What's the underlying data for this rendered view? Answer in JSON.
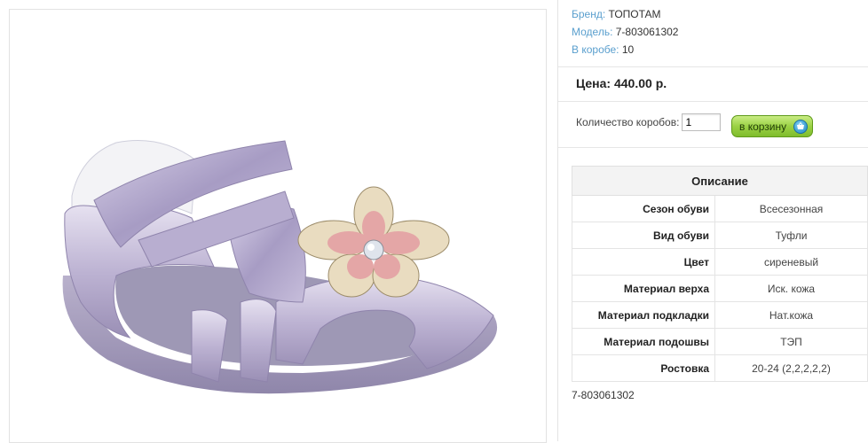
{
  "product": {
    "brand_label": "Бренд:",
    "brand": "ТОПОТАМ",
    "model_label": "Модель:",
    "model": "7-803061302",
    "box_label": "В коробе:",
    "box_qty": "10",
    "price_label": "Цена:",
    "price": "440.00 р.",
    "image_alt": "Сандалия для девочки сиреневая с цветком"
  },
  "order": {
    "qty_label": "Количество коробов:",
    "qty_value": "1",
    "cart_button": "в корзину"
  },
  "description": {
    "header": "Описание",
    "rows": [
      {
        "key": "Сезон обуви",
        "value": "Всесезонная"
      },
      {
        "key": "Вид обуви",
        "value": "Туфли"
      },
      {
        "key": "Цвет",
        "value": "сиреневый"
      },
      {
        "key": "Материал верха",
        "value": "Иск. кожа"
      },
      {
        "key": "Материал подкладки",
        "value": "Нат.кожа"
      },
      {
        "key": "Материал подошвы",
        "value": "ТЭП"
      },
      {
        "key": "Ростовка",
        "value": "20-24 (2,2,2,2,2)"
      }
    ],
    "footer_sku": "7-803061302"
  },
  "colors": {
    "label_blue": "#5a9fce",
    "button_green": "#9bd245",
    "shoe_lilac": "#c8c0dc"
  }
}
